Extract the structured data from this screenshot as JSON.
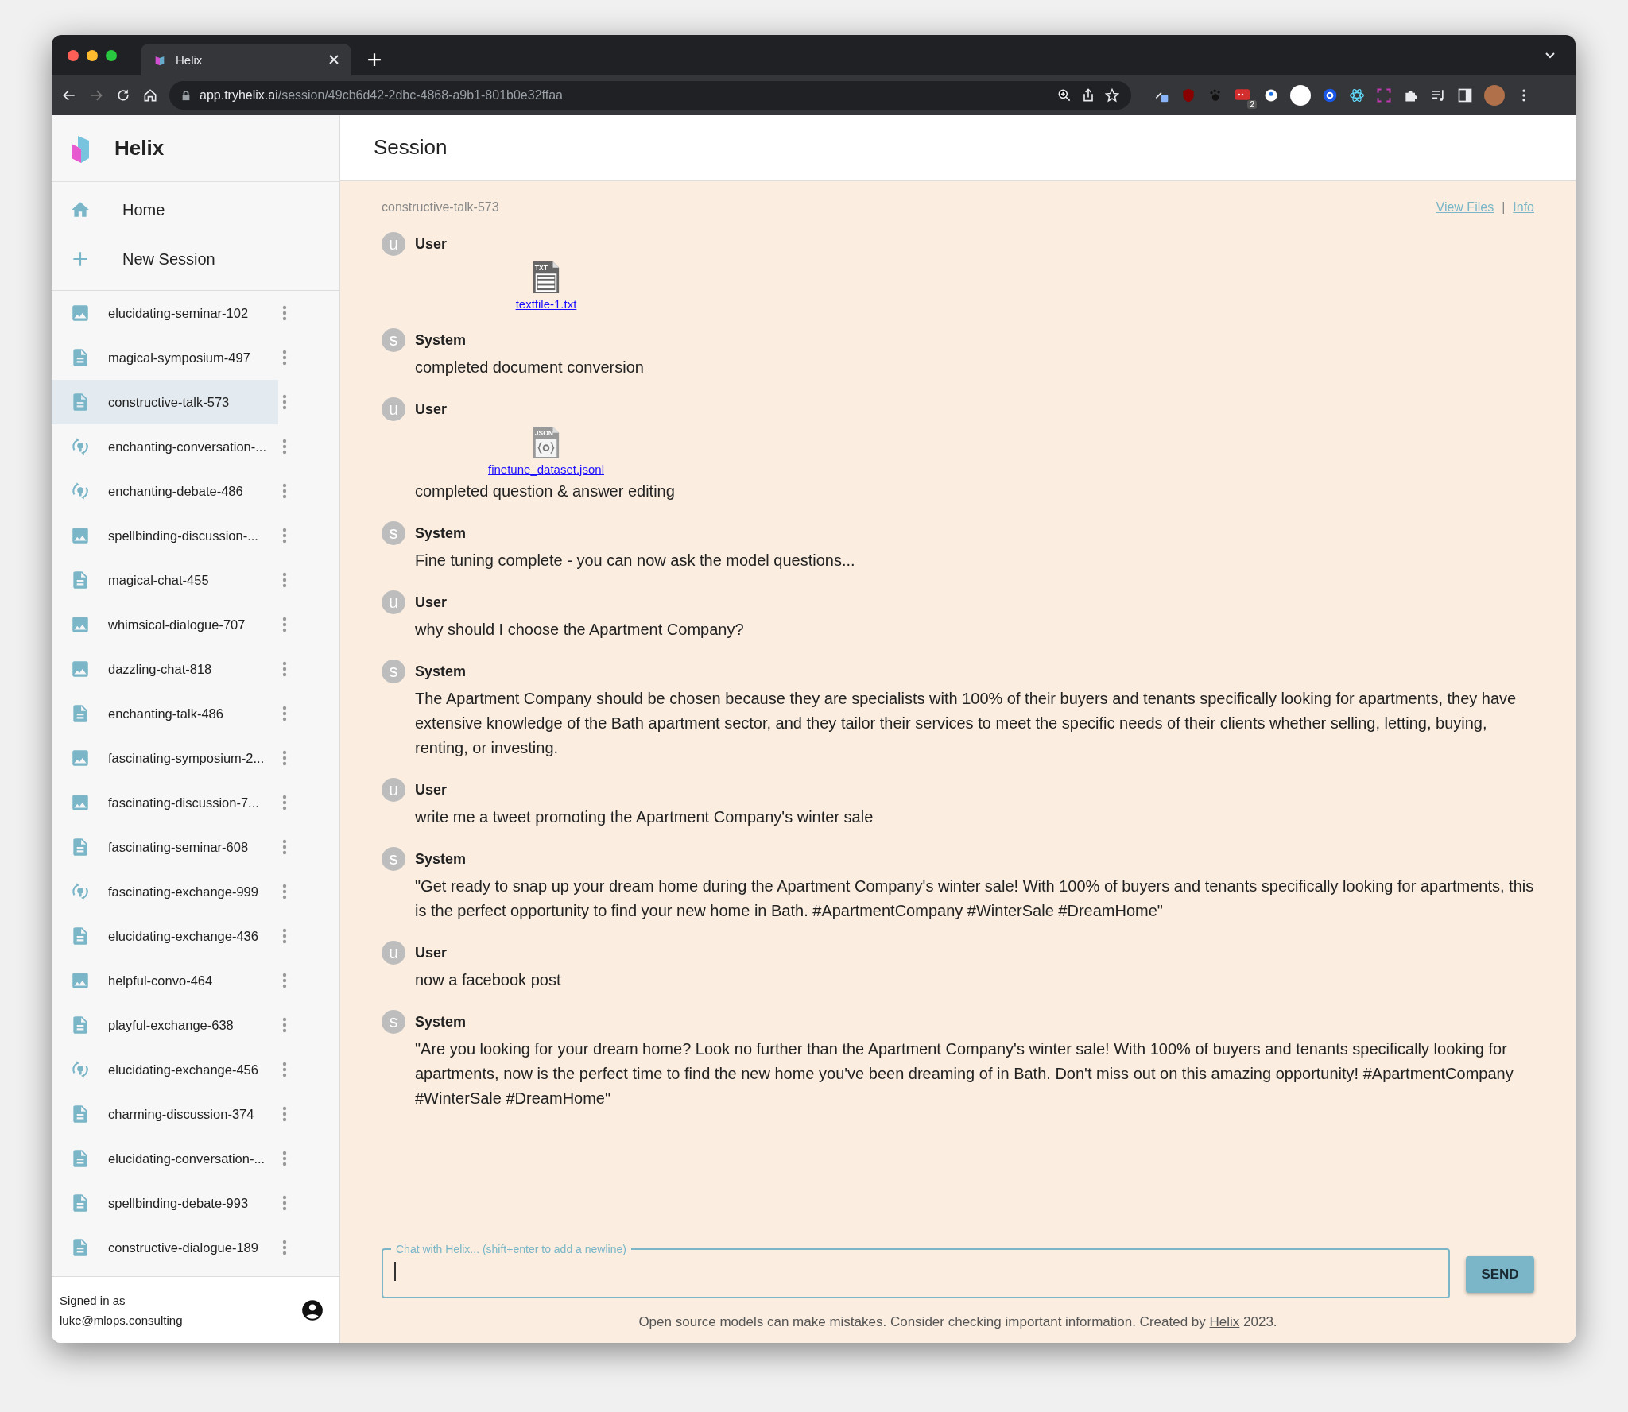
{
  "browser": {
    "tab_title": "Helix",
    "url_host": "app.tryhelix.ai",
    "url_path": "/session/49cb6d42-2dbc-4868-a9b1-801b0e32ffaa",
    "extension_badge": "2"
  },
  "sidebar": {
    "brand": "Helix",
    "nav": [
      {
        "kind": "home",
        "label": "Home"
      },
      {
        "kind": "new",
        "label": "New Session"
      }
    ],
    "sessions": [
      {
        "kind": "image",
        "name": "elucidating-seminar-102",
        "selected": false
      },
      {
        "kind": "text",
        "name": "magical-symposium-497",
        "selected": false
      },
      {
        "kind": "text",
        "name": "constructive-talk-573",
        "selected": true
      },
      {
        "kind": "finetune",
        "name": "enchanting-conversation-...",
        "selected": false
      },
      {
        "kind": "finetune",
        "name": "enchanting-debate-486",
        "selected": false
      },
      {
        "kind": "image",
        "name": "spellbinding-discussion-...",
        "selected": false
      },
      {
        "kind": "text",
        "name": "magical-chat-455",
        "selected": false
      },
      {
        "kind": "image",
        "name": "whimsical-dialogue-707",
        "selected": false
      },
      {
        "kind": "image",
        "name": "dazzling-chat-818",
        "selected": false
      },
      {
        "kind": "text",
        "name": "enchanting-talk-486",
        "selected": false
      },
      {
        "kind": "image",
        "name": "fascinating-symposium-2...",
        "selected": false
      },
      {
        "kind": "image",
        "name": "fascinating-discussion-7...",
        "selected": false
      },
      {
        "kind": "text",
        "name": "fascinating-seminar-608",
        "selected": false
      },
      {
        "kind": "finetune",
        "name": "fascinating-exchange-999",
        "selected": false
      },
      {
        "kind": "text",
        "name": "elucidating-exchange-436",
        "selected": false
      },
      {
        "kind": "image",
        "name": "helpful-convo-464",
        "selected": false
      },
      {
        "kind": "text",
        "name": "playful-exchange-638",
        "selected": false
      },
      {
        "kind": "finetune",
        "name": "elucidating-exchange-456",
        "selected": false
      },
      {
        "kind": "text",
        "name": "charming-discussion-374",
        "selected": false
      },
      {
        "kind": "text",
        "name": "elucidating-conversation-...",
        "selected": false
      },
      {
        "kind": "text",
        "name": "spellbinding-debate-993",
        "selected": false
      },
      {
        "kind": "text",
        "name": "constructive-dialogue-189",
        "selected": false
      }
    ],
    "signed_in_label": "Signed in as",
    "user_email": "luke@mlops.consulting"
  },
  "header": {
    "title": "Session"
  },
  "session": {
    "name": "constructive-talk-573",
    "links": [
      "View Files",
      "Info"
    ],
    "separator": "|",
    "messages": [
      {
        "avatar": "u",
        "role": "User",
        "file": {
          "kind": "txt",
          "badge": "TXT",
          "name": "textfile-1.txt"
        }
      },
      {
        "avatar": "s",
        "role": "System",
        "text": "completed document conversion"
      },
      {
        "avatar": "u",
        "role": "User",
        "file": {
          "kind": "json",
          "badge": "JSON",
          "name": "finetune_dataset.jsonl"
        },
        "text": "completed question & answer editing"
      },
      {
        "avatar": "s",
        "role": "System",
        "text": "Fine tuning complete - you can now ask the model questions..."
      },
      {
        "avatar": "u",
        "role": "User",
        "text": "why should I choose the Apartment Company?"
      },
      {
        "avatar": "s",
        "role": "System",
        "text": "The Apartment Company should be chosen because they are specialists with 100% of their buyers and tenants specifically looking for apartments, they have extensive knowledge of the Bath apartment sector, and they tailor their services to meet the specific needs of their clients whether selling, letting, buying, renting, or investing."
      },
      {
        "avatar": "u",
        "role": "User",
        "text": "write me a tweet promoting the Apartment Company's winter sale"
      },
      {
        "avatar": "s",
        "role": "System",
        "text": "\"Get ready to snap up your dream home during the Apartment Company's winter sale! With 100% of buyers and tenants specifically looking for apartments, this is the perfect opportunity to find your new home in Bath. #ApartmentCompany #WinterSale #DreamHome\""
      },
      {
        "avatar": "u",
        "role": "User",
        "text": "now a facebook post"
      },
      {
        "avatar": "s",
        "role": "System",
        "text": "\"Are you looking for your dream home? Look no further than the Apartment Company's winter sale! With 100% of buyers and tenants specifically looking for apartments, now is the perfect time to find the new home you've been dreaming of in Bath. Don't miss out on this amazing opportunity! #ApartmentCompany #WinterSale #DreamHome\""
      }
    ]
  },
  "composer": {
    "label": "Chat with Helix... (shift+enter to add a newline)",
    "send": "SEND"
  },
  "footer": {
    "before": "Open source models can make mistakes. Consider checking important information. Created by",
    "link": "Helix",
    "after": "2023."
  }
}
